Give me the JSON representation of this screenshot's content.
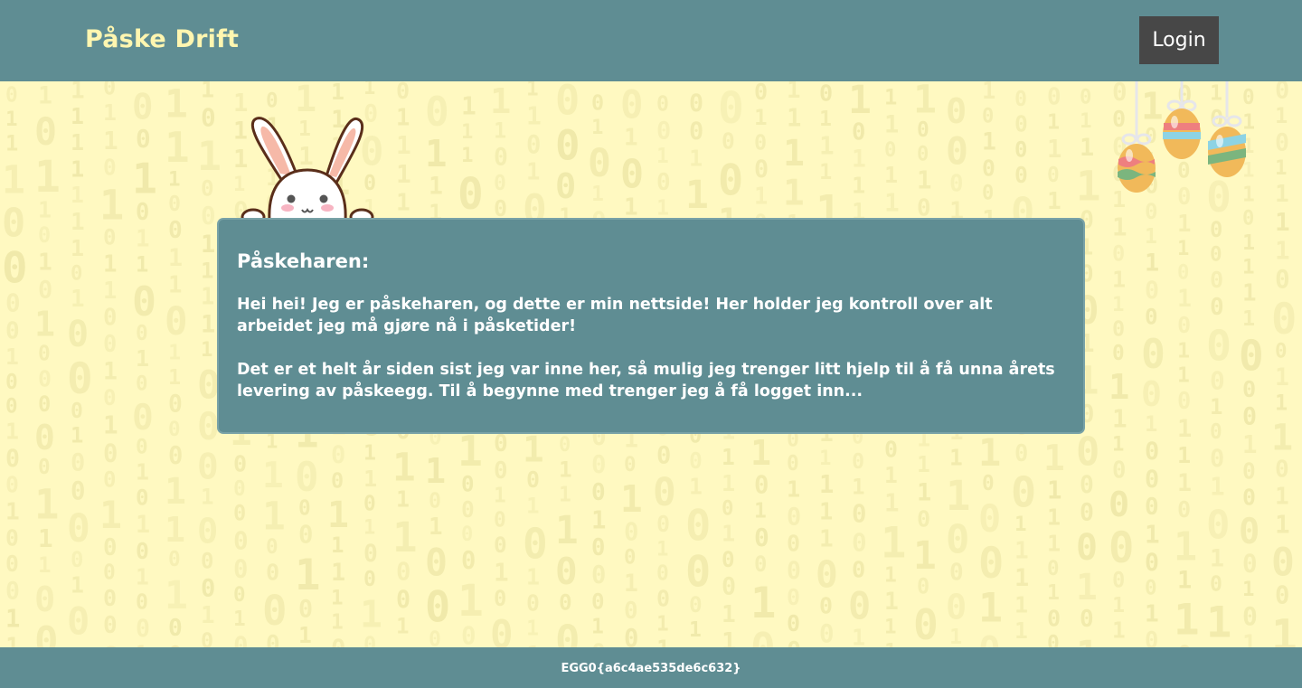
{
  "header": {
    "brand": "Påske Drift",
    "login_label": "Login"
  },
  "card": {
    "title": "Påskeharen:",
    "paragraphs": [
      "Hei hei! Jeg er påskeharen, og dette er min nettside! Her holder jeg kontroll over alt arbeidet jeg må gjøre nå i påsketider!",
      "Det er et helt år siden sist jeg var inne her, så mulig jeg trenger litt hjelp til å få unna årets levering av påskeegg. Til å begynne med trenger jeg å få logget inn..."
    ]
  },
  "footer": {
    "text": "EGG0{a6c4ae535de6c632}"
  },
  "decor": {
    "bunny": "easter-bunny-illustration",
    "eggs": "hanging-easter-eggs",
    "background": "binary-digits-pattern"
  },
  "colors": {
    "header_bg": "#5f8d93",
    "page_bg": "#fff9c1",
    "brand_text": "#fff6b0",
    "login_bg": "#474747"
  }
}
